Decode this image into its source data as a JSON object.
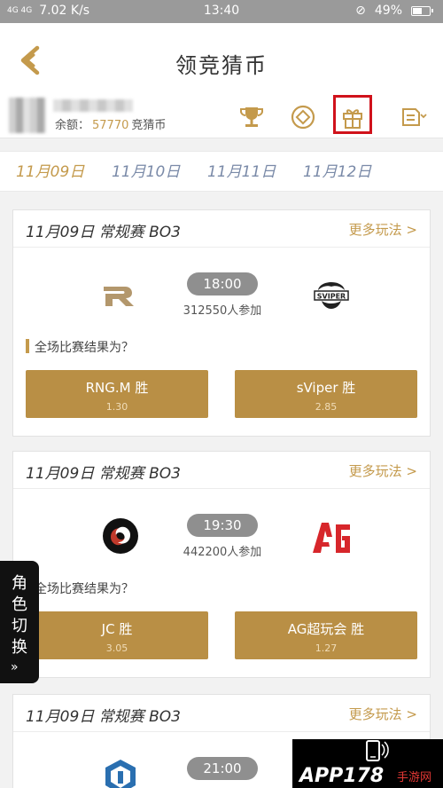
{
  "status_bar": {
    "signal": "4G 4G",
    "speed": "7.02 K/s",
    "time": "13:40",
    "battery": "49%",
    "battery_fraction": 0.49
  },
  "header": {
    "title": "领竞猜币"
  },
  "user": {
    "balance_label": "余额：",
    "balance_value": "57770",
    "balance_unit": "竞猜币"
  },
  "icons": {
    "trophy": "trophy-icon",
    "coin": "coin-icon",
    "gift": "gift-icon",
    "menu": "menu-icon"
  },
  "date_tabs": [
    {
      "label": "11月09日",
      "active": true
    },
    {
      "label": "11月10日",
      "active": false
    },
    {
      "label": "11月11日",
      "active": false
    },
    {
      "label": "11月12日",
      "active": false
    }
  ],
  "matches": [
    {
      "title": "11月09日 常规赛 BO3",
      "more": "更多玩法 >",
      "team_a": "RNG.M",
      "team_b": "sViper",
      "time": "18:00",
      "participants": "312550人参加",
      "question": "全场比赛结果为？",
      "bet_a": {
        "label": "RNG.M 胜",
        "odds": "1.30"
      },
      "bet_b": {
        "label": "sViper 胜",
        "odds": "2.85"
      }
    },
    {
      "title": "11月09日 常规赛 BO3",
      "more": "更多玩法 >",
      "team_a": "JC",
      "team_b": "AG",
      "time": "19:30",
      "participants": "442200人参加",
      "question": "全场比赛结果为？",
      "bet_a": {
        "label": "JC 胜",
        "odds": "3.05"
      },
      "bet_b": {
        "label": "AG超玩会 胜",
        "odds": "1.27"
      }
    },
    {
      "title": "11月09日 常规赛 BO3",
      "more": "更多玩法 >",
      "time": "21:00"
    }
  ],
  "role_switch": {
    "label": "角色切换",
    "arrow": "»"
  },
  "watermark": {
    "text": "APP178",
    "sub": "手游网"
  },
  "colors": {
    "accent": "#c49a4c",
    "button": "#b98f45",
    "highlight": "#d0121b",
    "date_tab": "#7a8aa8"
  }
}
